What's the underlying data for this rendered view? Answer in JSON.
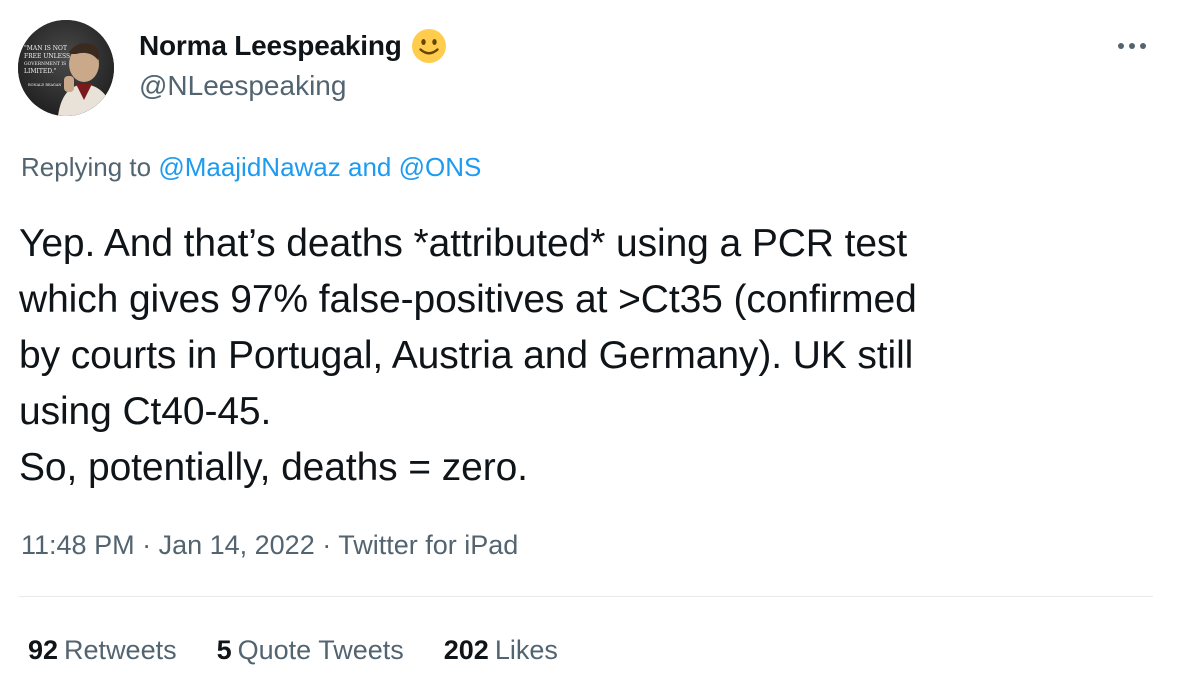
{
  "user": {
    "display_name": "Norma Leespeaking",
    "handle": "@NLeespeaking",
    "avatar_caption": "\"Man is not free unless government is limited.\" Ronald Reagan"
  },
  "reply": {
    "prefix": "Replying to ",
    "mention_1": "@MaajidNawaz",
    "conjunction": " and ",
    "mention_2": "@ONS"
  },
  "tweet": {
    "text": "Yep. And that’s deaths *attributed* using a PCR test\nwhich gives 97% false-positives at >Ct35 (confirmed\nby courts in Portugal, Austria and Germany). UK still\nusing Ct40-45.\nSo, potentially, deaths = zero."
  },
  "meta": {
    "time": "11:48 PM",
    "separator": " · ",
    "date": "Jan 14, 2022",
    "source": "Twitter for iPad"
  },
  "stats": {
    "retweets_count": "92",
    "retweets_label": "Retweets",
    "quotes_count": "5",
    "quotes_label": "Quote Tweets",
    "likes_count": "202",
    "likes_label": "Likes"
  },
  "colors": {
    "text": "#0f1419",
    "secondary": "#536471",
    "link": "#1d9bf0",
    "divider": "#e7e9ea"
  },
  "icons": {
    "emoji": "slightly-smiling-face-icon",
    "more": "more-horizontal-icon"
  }
}
